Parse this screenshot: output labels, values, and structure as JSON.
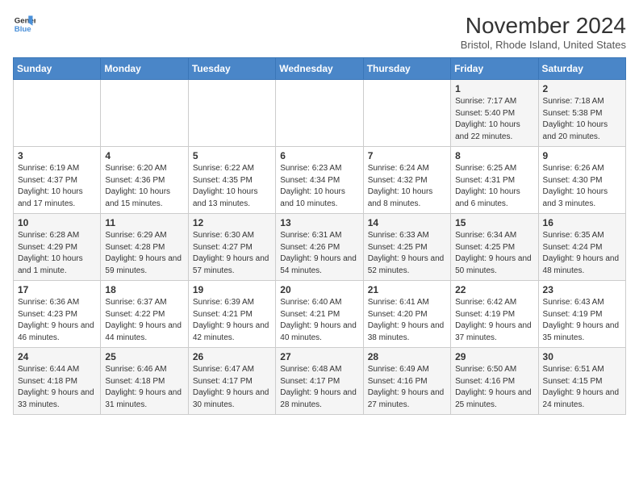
{
  "header": {
    "logo_line1": "General",
    "logo_line2": "Blue",
    "month": "November 2024",
    "location": "Bristol, Rhode Island, United States"
  },
  "weekdays": [
    "Sunday",
    "Monday",
    "Tuesday",
    "Wednesday",
    "Thursday",
    "Friday",
    "Saturday"
  ],
  "weeks": [
    [
      {
        "day": "",
        "info": ""
      },
      {
        "day": "",
        "info": ""
      },
      {
        "day": "",
        "info": ""
      },
      {
        "day": "",
        "info": ""
      },
      {
        "day": "",
        "info": ""
      },
      {
        "day": "1",
        "info": "Sunrise: 7:17 AM\nSunset: 5:40 PM\nDaylight: 10 hours and 22 minutes."
      },
      {
        "day": "2",
        "info": "Sunrise: 7:18 AM\nSunset: 5:38 PM\nDaylight: 10 hours and 20 minutes."
      }
    ],
    [
      {
        "day": "3",
        "info": "Sunrise: 6:19 AM\nSunset: 4:37 PM\nDaylight: 10 hours and 17 minutes."
      },
      {
        "day": "4",
        "info": "Sunrise: 6:20 AM\nSunset: 4:36 PM\nDaylight: 10 hours and 15 minutes."
      },
      {
        "day": "5",
        "info": "Sunrise: 6:22 AM\nSunset: 4:35 PM\nDaylight: 10 hours and 13 minutes."
      },
      {
        "day": "6",
        "info": "Sunrise: 6:23 AM\nSunset: 4:34 PM\nDaylight: 10 hours and 10 minutes."
      },
      {
        "day": "7",
        "info": "Sunrise: 6:24 AM\nSunset: 4:32 PM\nDaylight: 10 hours and 8 minutes."
      },
      {
        "day": "8",
        "info": "Sunrise: 6:25 AM\nSunset: 4:31 PM\nDaylight: 10 hours and 6 minutes."
      },
      {
        "day": "9",
        "info": "Sunrise: 6:26 AM\nSunset: 4:30 PM\nDaylight: 10 hours and 3 minutes."
      }
    ],
    [
      {
        "day": "10",
        "info": "Sunrise: 6:28 AM\nSunset: 4:29 PM\nDaylight: 10 hours and 1 minute."
      },
      {
        "day": "11",
        "info": "Sunrise: 6:29 AM\nSunset: 4:28 PM\nDaylight: 9 hours and 59 minutes."
      },
      {
        "day": "12",
        "info": "Sunrise: 6:30 AM\nSunset: 4:27 PM\nDaylight: 9 hours and 57 minutes."
      },
      {
        "day": "13",
        "info": "Sunrise: 6:31 AM\nSunset: 4:26 PM\nDaylight: 9 hours and 54 minutes."
      },
      {
        "day": "14",
        "info": "Sunrise: 6:33 AM\nSunset: 4:25 PM\nDaylight: 9 hours and 52 minutes."
      },
      {
        "day": "15",
        "info": "Sunrise: 6:34 AM\nSunset: 4:25 PM\nDaylight: 9 hours and 50 minutes."
      },
      {
        "day": "16",
        "info": "Sunrise: 6:35 AM\nSunset: 4:24 PM\nDaylight: 9 hours and 48 minutes."
      }
    ],
    [
      {
        "day": "17",
        "info": "Sunrise: 6:36 AM\nSunset: 4:23 PM\nDaylight: 9 hours and 46 minutes."
      },
      {
        "day": "18",
        "info": "Sunrise: 6:37 AM\nSunset: 4:22 PM\nDaylight: 9 hours and 44 minutes."
      },
      {
        "day": "19",
        "info": "Sunrise: 6:39 AM\nSunset: 4:21 PM\nDaylight: 9 hours and 42 minutes."
      },
      {
        "day": "20",
        "info": "Sunrise: 6:40 AM\nSunset: 4:21 PM\nDaylight: 9 hours and 40 minutes."
      },
      {
        "day": "21",
        "info": "Sunrise: 6:41 AM\nSunset: 4:20 PM\nDaylight: 9 hours and 38 minutes."
      },
      {
        "day": "22",
        "info": "Sunrise: 6:42 AM\nSunset: 4:19 PM\nDaylight: 9 hours and 37 minutes."
      },
      {
        "day": "23",
        "info": "Sunrise: 6:43 AM\nSunset: 4:19 PM\nDaylight: 9 hours and 35 minutes."
      }
    ],
    [
      {
        "day": "24",
        "info": "Sunrise: 6:44 AM\nSunset: 4:18 PM\nDaylight: 9 hours and 33 minutes."
      },
      {
        "day": "25",
        "info": "Sunrise: 6:46 AM\nSunset: 4:18 PM\nDaylight: 9 hours and 31 minutes."
      },
      {
        "day": "26",
        "info": "Sunrise: 6:47 AM\nSunset: 4:17 PM\nDaylight: 9 hours and 30 minutes."
      },
      {
        "day": "27",
        "info": "Sunrise: 6:48 AM\nSunset: 4:17 PM\nDaylight: 9 hours and 28 minutes."
      },
      {
        "day": "28",
        "info": "Sunrise: 6:49 AM\nSunset: 4:16 PM\nDaylight: 9 hours and 27 minutes."
      },
      {
        "day": "29",
        "info": "Sunrise: 6:50 AM\nSunset: 4:16 PM\nDaylight: 9 hours and 25 minutes."
      },
      {
        "day": "30",
        "info": "Sunrise: 6:51 AM\nSunset: 4:15 PM\nDaylight: 9 hours and 24 minutes."
      }
    ]
  ]
}
